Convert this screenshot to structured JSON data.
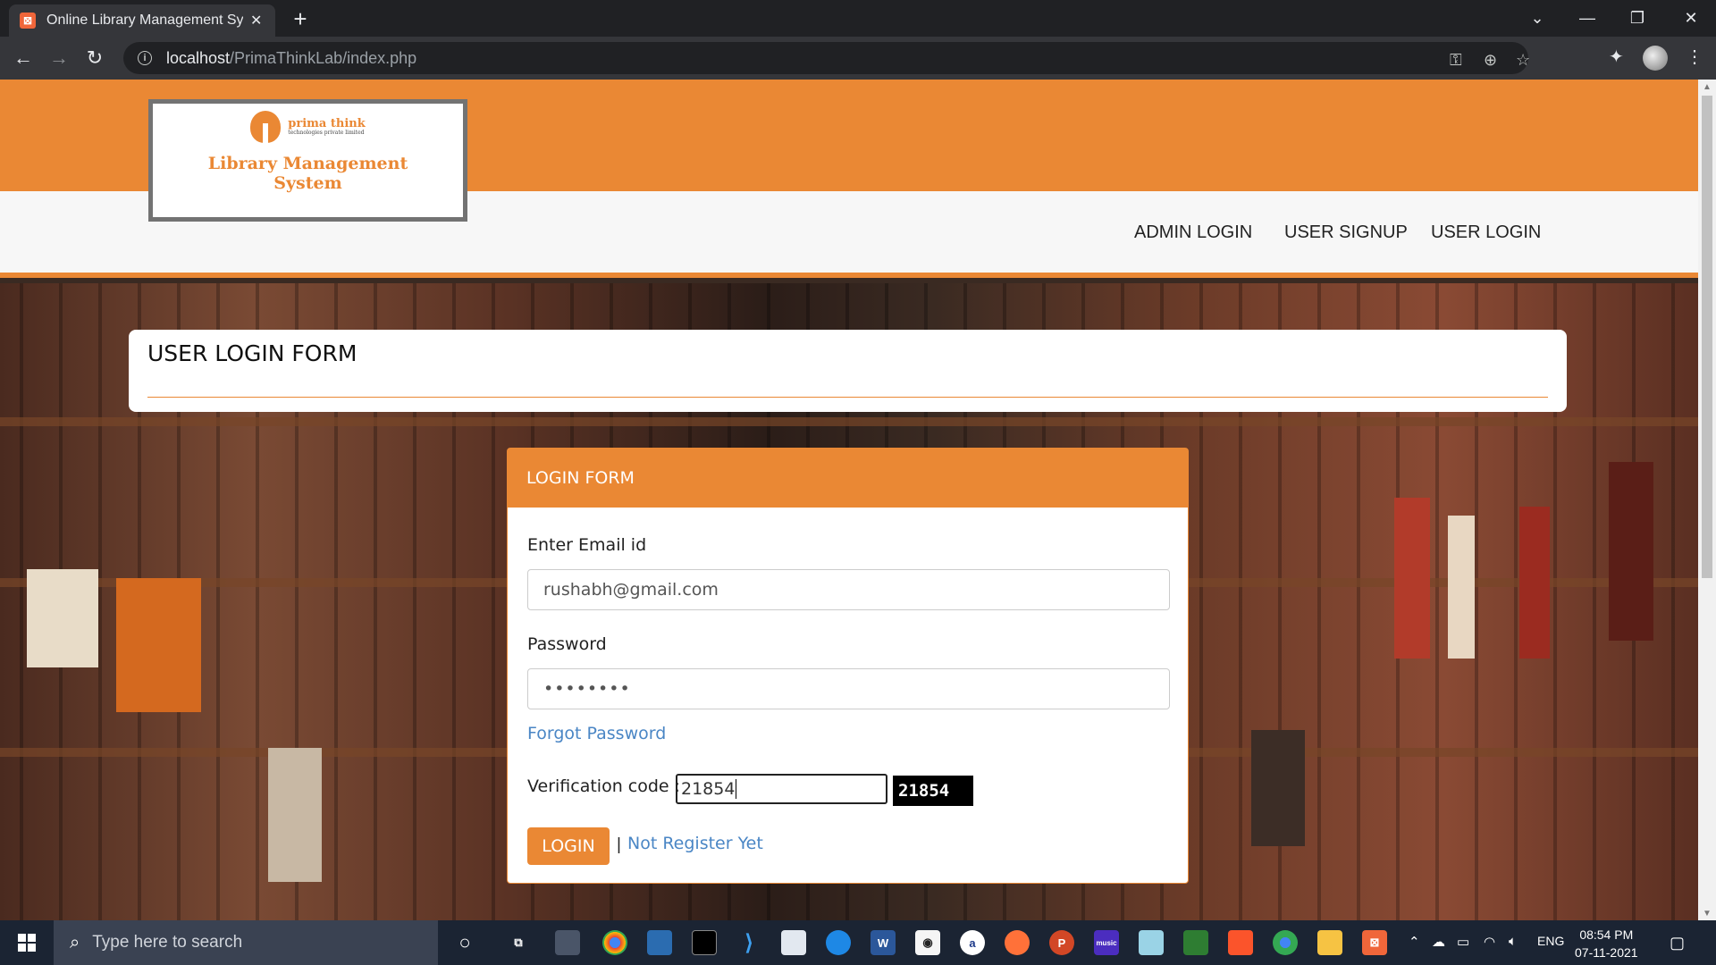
{
  "browser": {
    "tab_title": "Online Library Management System",
    "tab_favicon_icon": "xampp-icon",
    "url_host": "localhost",
    "url_path": "/PrimaThinkLab/index.php"
  },
  "header": {
    "logo": {
      "brand_name": "prima think",
      "brand_sub": "technologies private limited",
      "title_line1": "Library Management",
      "title_line2": "System"
    },
    "nav": [
      "ADMIN LOGIN",
      "USER SIGNUP",
      "USER LOGIN"
    ]
  },
  "page": {
    "title": "USER LOGIN FORM"
  },
  "login_form": {
    "heading": "LOGIN FORM",
    "email_label": "Enter Email id",
    "email_value": "rushabh@gmail.com",
    "password_label": "Password",
    "password_value": "••••••••",
    "forgot_link": "Forgot Password",
    "verification_label": "Verification code :",
    "verification_input": "21854",
    "verification_code": "21854",
    "login_button": "LOGIN",
    "separator": "|",
    "register_link": "Not Register Yet"
  },
  "taskbar": {
    "search_placeholder": "Type here to search",
    "language": "ENG",
    "time": "08:54 PM",
    "date": "07-11-2021"
  },
  "colors": {
    "accent": "#ea8834",
    "link": "#4a86c5"
  }
}
